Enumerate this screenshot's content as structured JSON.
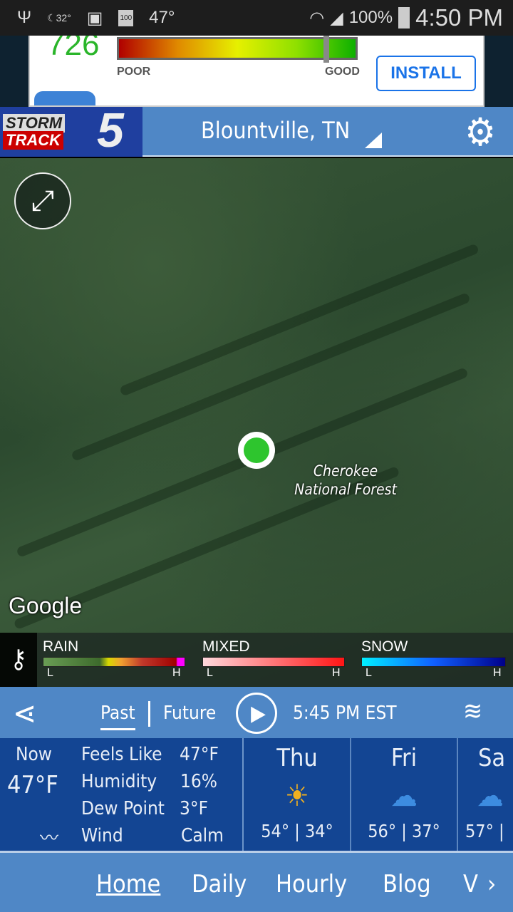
{
  "status_bar": {
    "moon_temp": "32°",
    "battery_small": "100",
    "temp": "47°",
    "battery": "100%",
    "time": "4:50 PM"
  },
  "ad": {
    "score": "726",
    "poor": "POOR",
    "good": "GOOD",
    "install": "INSTALL",
    "gauge_level": 0.87
  },
  "header": {
    "logo": "STORM TRACK 5",
    "location": "Blountville, TN"
  },
  "map": {
    "label": "Cherokee National Forest",
    "attribution": "Google"
  },
  "legend": {
    "rain": "RAIN",
    "mixed": "MIXED",
    "snow": "SNOW",
    "low": "L",
    "high": "H"
  },
  "controls": {
    "past": "Past",
    "future": "Future",
    "timestamp": "5:45 PM EST"
  },
  "current": {
    "now": "Now",
    "temp": "47°F",
    "feels_label": "Feels Like",
    "feels": "47°F",
    "humidity_label": "Humidity",
    "humidity": "16%",
    "dew_label": "Dew Point",
    "dew": "3°F",
    "wind_label": "Wind",
    "wind": "Calm"
  },
  "forecast": [
    {
      "day": "Thu",
      "icon": "sunny",
      "high": "54°",
      "low": "34°"
    },
    {
      "day": "Fri",
      "icon": "rain",
      "high": "56°",
      "low": "37°"
    },
    {
      "day": "Sa",
      "icon": "rain",
      "high": "57°",
      "low": ""
    }
  ],
  "nav": {
    "home": "Home",
    "daily": "Daily",
    "hourly": "Hourly",
    "blog": "Blog",
    "more": "V"
  },
  "colors": {
    "header": "#4f87c6",
    "panel": "#134593",
    "accent": "#1a73e8"
  }
}
